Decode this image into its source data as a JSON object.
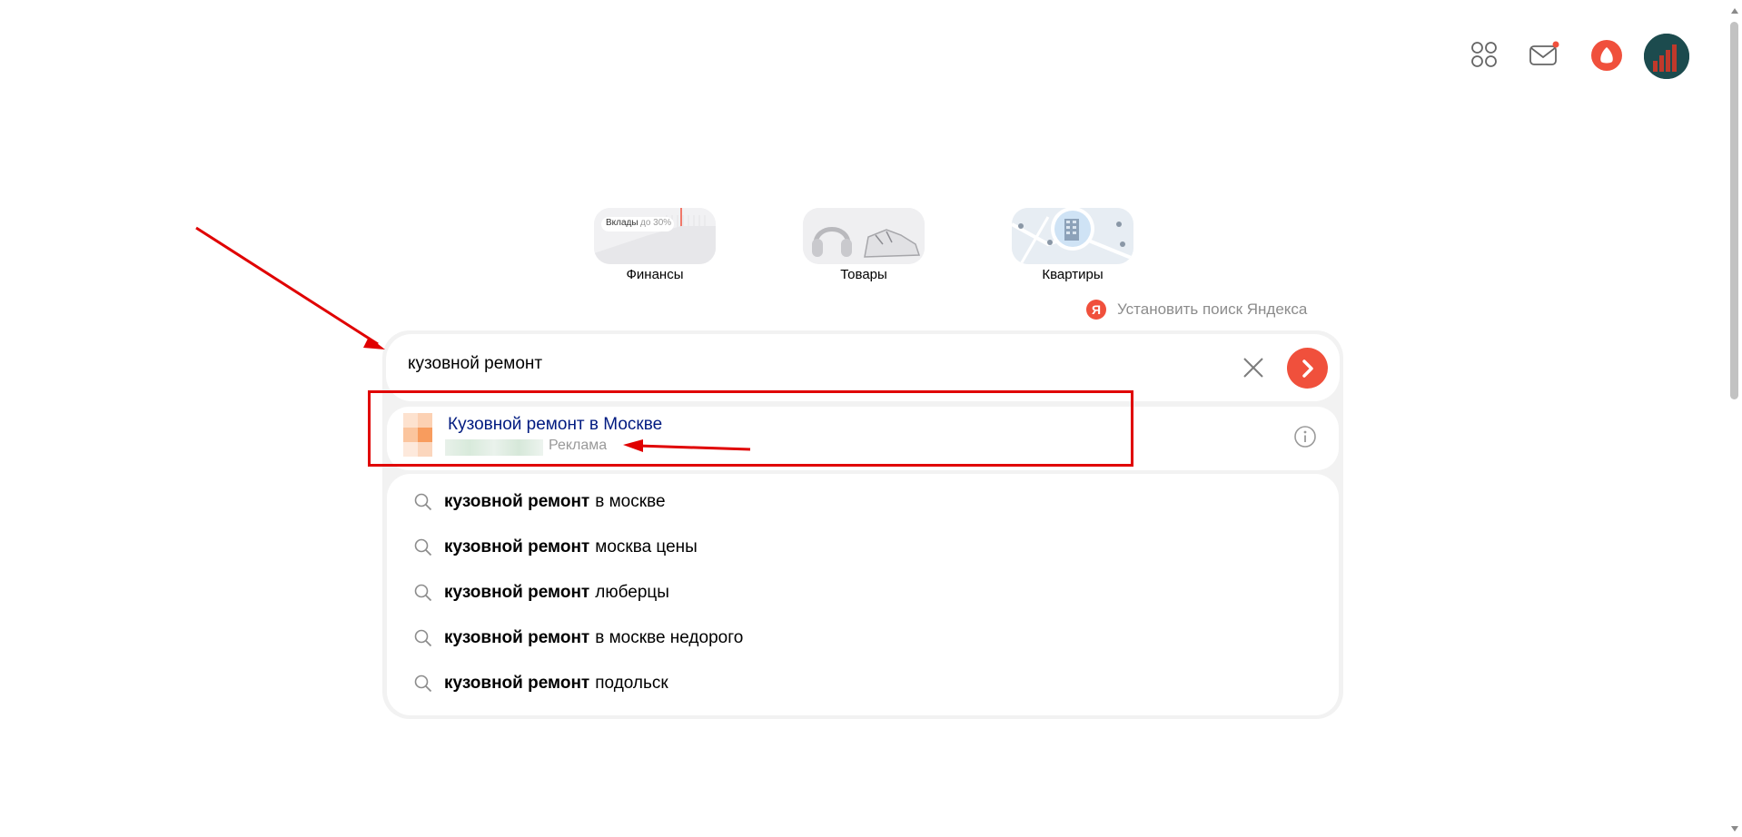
{
  "header": {
    "icons": [
      "apps-grid-icon",
      "mail-icon",
      "alice-icon",
      "avatar"
    ]
  },
  "tiles": [
    {
      "label": "Финансы",
      "preview_text": "Вклады",
      "preview_sub": "до 30%"
    },
    {
      "label": "Товары"
    },
    {
      "label": "Квартиры"
    }
  ],
  "install": {
    "badge": "Я",
    "text": "Установить поиск Яндекса"
  },
  "search": {
    "value": "кузовной ремонт",
    "submit_glyph": "❯"
  },
  "ad": {
    "title": "Кузовной ремонт в Москве",
    "label": "Реклама"
  },
  "suggestions": [
    {
      "bold": "кузовной ремонт",
      "rest": "в москве"
    },
    {
      "bold": "кузовной ремонт",
      "rest": "москва цены"
    },
    {
      "bold": "кузовной ремонт",
      "rest": "люберцы"
    },
    {
      "bold": "кузовной ремонт",
      "rest": "в москве недорого"
    },
    {
      "bold": "кузовной ремонт",
      "rest": "подольск"
    }
  ],
  "colors": {
    "accent": "#f0503c",
    "annotation": "#e00000",
    "ad_title": "#001a80"
  }
}
